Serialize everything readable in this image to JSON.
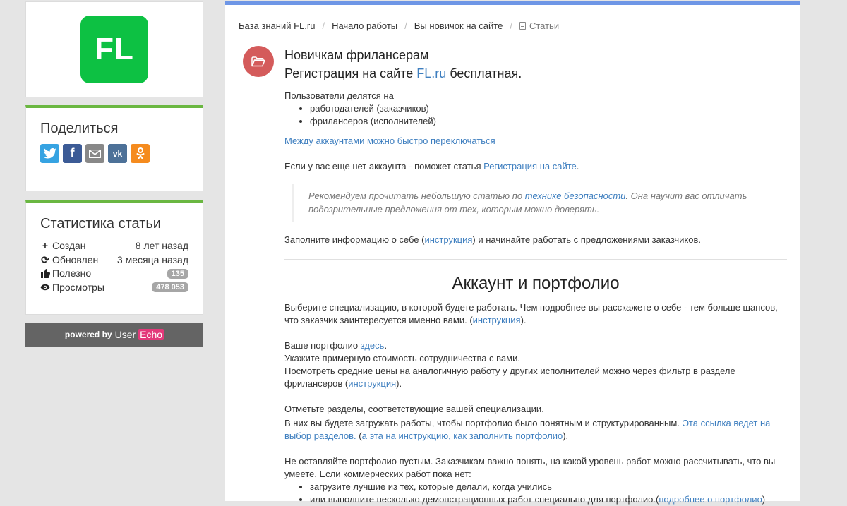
{
  "sidebar": {
    "logo_text": "FL",
    "share": {
      "title": "Поделиться",
      "icons": [
        {
          "name": "twitter-icon",
          "glyph": "🐦",
          "color": "#36a3e2"
        },
        {
          "name": "facebook-icon",
          "glyph": "f",
          "color": "#3c5b96"
        },
        {
          "name": "email-icon",
          "glyph": "✉",
          "color": "#888888"
        },
        {
          "name": "vk-icon",
          "glyph": "vk",
          "color": "#4d7198"
        },
        {
          "name": "odnoklassniki-icon",
          "glyph": "ок",
          "color": "#f58b1e"
        }
      ]
    },
    "stats": {
      "title": "Статистика статьи",
      "created_label": "Создан",
      "created_value": "8 лет назад",
      "updated_label": "Обновлен",
      "updated_value": "3 месяца назад",
      "useful_label": "Полезно",
      "useful_value": "135",
      "views_label": "Просмотры",
      "views_value": "478 053"
    },
    "powered": {
      "prefix": "powered by",
      "user": "User",
      "echo": "Echo"
    }
  },
  "breadcrumb": {
    "items": [
      "База знаний FL.ru",
      "Начало работы",
      "Вы новичок на сайте"
    ],
    "current": "Статьи"
  },
  "article": {
    "title": "Новичкам фрилансерам",
    "subtitle_pre": "Регистрация на сайте ",
    "subtitle_link": "FL.ru",
    "subtitle_post": " бесплатная.",
    "users_share": "Пользователи делятся на",
    "user_types": [
      "работодателей (заказчиков)",
      "фрилансеров (исполнителей)"
    ],
    "switch_link": "Между аккаунтами можно быстро переключаться",
    "no_account_pre": "Если у вас еще нет аккаунта - поможет статья ",
    "no_account_link": "Регистрация на сайте",
    "no_account_post": ".",
    "quote_pre": "Рекомендуем прочитать небольшую статью по ",
    "quote_link": "технике безопасности",
    "quote_post": ". Она научит вас отличать подозрительные предложения от тех, которым можно доверять.",
    "fill_pre": "Заполните информацию о себе (",
    "fill_link": "инструкция",
    "fill_post": ") и начинайте работать с предложениями заказчиков.",
    "section_title": "Аккаунт и портфолио",
    "spec_pre": "Выберите специализацию, в которой будете работать. Чем подробнее вы расскажете о себе - тем больше шансов, что заказчик заинтересуется именно вами. (",
    "spec_link": "инструкция",
    "spec_post": ").",
    "portfolio_pre": "Ваше портфолио ",
    "portfolio_link": "здесь",
    "portfolio_post": ".",
    "cost_line": "Укажите примерную стоимость сотрудничества с вами.",
    "prices_pre": "Посмотреть средние цены на аналогичную работу у других исполнителей можно через фильтр в разделе фрилансеров (",
    "prices_link": "инструкция",
    "prices_post": ").",
    "sections_line": "Отметьте разделы, соответствующие вашей специализации.",
    "works_pre": "В них вы будете загружать работы, чтобы портфолио было понятным и структурированным. ",
    "works_link1": "Эта ссылка ведет на выбор разделов.",
    "works_mid": " (",
    "works_link2": "а эта на инструкцию, как заполнить портфолио",
    "works_post": ").",
    "empty_line": "Не оставляйте портфолио пустым. Заказчикам важно понять, на какой уровень работ можно рассчитывать, что вы умеете. Если коммерческих работ пока нет:",
    "tips_item1": "загрузите лучшие из тех, которые делали, когда учились",
    "tips_item2_pre": "или выполните несколько демонстрационных работ специально для портфолио.(",
    "tips_item2_link": "подробнее о портфолио",
    "tips_item2_post": ")"
  },
  "colors": {
    "brand_green": "#0dc143",
    "accent_blue": "#6e96e6",
    "link": "#3d7ebf",
    "folder_red": "#d45b5b"
  }
}
